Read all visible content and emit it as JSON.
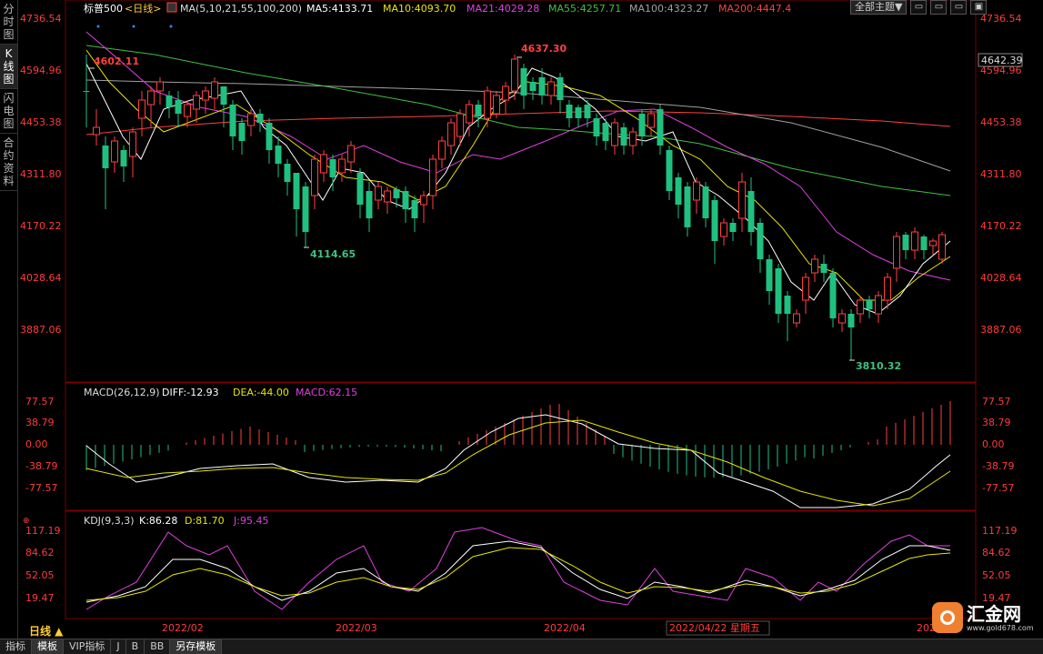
{
  "sidebar": {
    "tabs": [
      {
        "label": "分时图"
      },
      {
        "label": "K线图"
      },
      {
        "label": "闪电图"
      },
      {
        "label": "合约资料"
      }
    ]
  },
  "header": {
    "title": "标普500",
    "period": "<日线>",
    "ma_label": "MA(5,10,21,55,100,200)",
    "ma": [
      {
        "label": "MA5:4133.71",
        "color": "#ffffff"
      },
      {
        "label": "MA10:4093.70",
        "color": "#e6e600"
      },
      {
        "label": "MA21:4029.28",
        "color": "#e040e0"
      },
      {
        "label": "MA55:4257.71",
        "color": "#40c040"
      },
      {
        "label": "MA100:4323.27",
        "color": "#a0a0a0"
      },
      {
        "label": "MA200:4447.4",
        "color": "#ff4040"
      }
    ],
    "theme_button": "全部主题▼",
    "window_buttons": [
      "▭",
      "▭",
      "▭",
      "▣"
    ]
  },
  "price_axis": {
    "ticks": [
      "4736.54",
      "4594.96",
      "4453.38",
      "4311.80",
      "4170.22",
      "4028.64",
      "3887.06"
    ],
    "current_price": "4642.39"
  },
  "annotations": {
    "high1": "4602.11",
    "high2": "4637.30",
    "low1": "4114.65",
    "low2": "3810.32"
  },
  "macd": {
    "label": "MACD(26,12,9)",
    "diff": "DIFF:-12.93",
    "dea": "DEA:-44.00",
    "macd": "MACD:62.15",
    "ticks": [
      "77.57",
      "38.79",
      "0.00",
      "-38.79",
      "-77.57"
    ]
  },
  "kdj": {
    "label": "KDJ(9,3,3)",
    "k": "K:86.28",
    "d": "D:81.70",
    "j": "J:95.45",
    "ticks": [
      "117.19",
      "84.62",
      "52.05",
      "19.47"
    ]
  },
  "x_axis": {
    "dates": [
      "2022/02",
      "2022/03",
      "2022/04",
      "2022/04/22 星期五",
      "2022/05"
    ]
  },
  "colors": {
    "up": "#ff4040",
    "down": "#20c080",
    "axis_text": "#ff3b3b",
    "grid": "#7a0000"
  },
  "period_button": "日线 ▲",
  "bottom_tabs": [
    "指标",
    "模板",
    "VIP指标",
    "J",
    "B",
    "BB",
    "另存模板"
  ],
  "brand": {
    "name": "汇金网",
    "url": "www.gold678.com"
  }
}
